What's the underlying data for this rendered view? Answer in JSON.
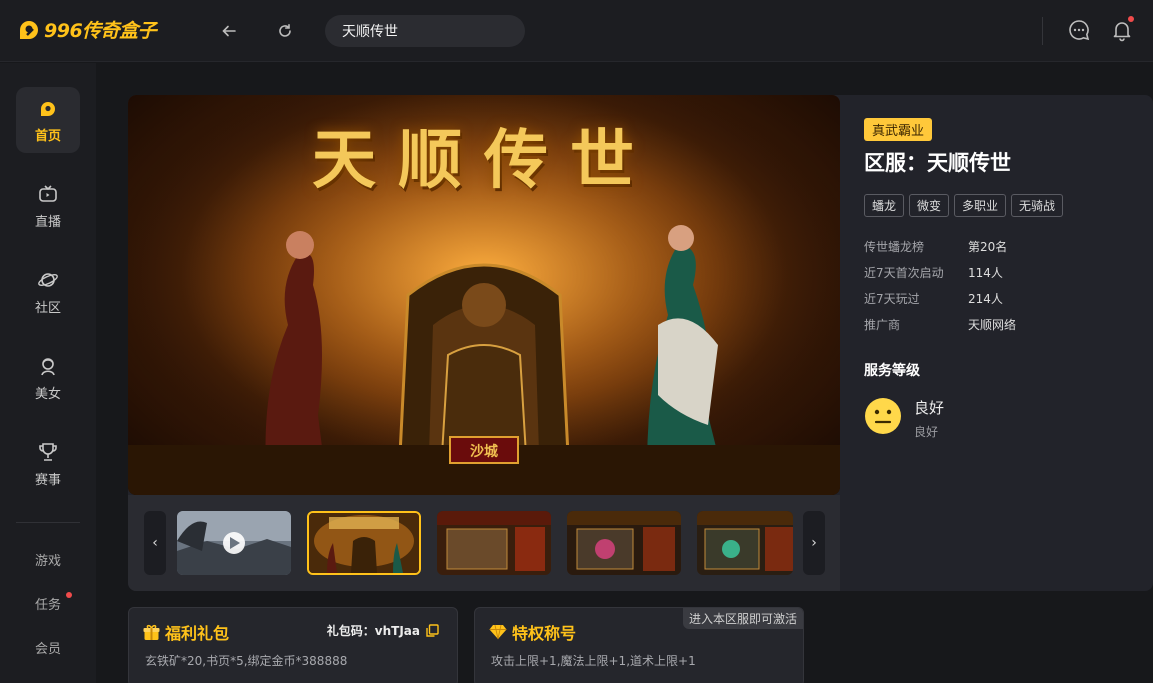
{
  "header": {
    "logo_text": "996传奇盒子",
    "search_value": "天顺传世",
    "colors": {
      "brand": "#ffc21a",
      "bg": "#17181b",
      "notify_dot": "#f04b4b"
    }
  },
  "sidebar": {
    "items": [
      {
        "label": "首页",
        "icon": "home-icon"
      },
      {
        "label": "直播",
        "icon": "tv-icon"
      },
      {
        "label": "社区",
        "icon": "planet-icon"
      },
      {
        "label": "美女",
        "icon": "girl-icon"
      },
      {
        "label": "赛事",
        "icon": "trophy-icon"
      }
    ],
    "links": [
      "游戏",
      "任务",
      "会员"
    ]
  },
  "hero": {
    "banner_title": "天顺传世",
    "banner_sign": "沙城"
  },
  "info": {
    "genre": "真武霸业",
    "server_name": "区服：天顺传世",
    "tags": [
      "蟠龙",
      "微变",
      "多职业",
      "无骑战"
    ],
    "stats": [
      {
        "label": "传世蟠龙榜",
        "value": "第20名"
      },
      {
        "label": "近7天首次启动",
        "value": "114人"
      },
      {
        "label": "近7天玩过",
        "value": "214人"
      },
      {
        "label": "推广商",
        "value": "天顺网络"
      }
    ],
    "service_heading": "服务等级",
    "service_level": "良好",
    "service_sub": "良好"
  },
  "cards": {
    "gift": {
      "title": "福利礼包",
      "code_label": "礼包码：vhTJaa",
      "desc": "玄铁矿*20,书页*5,绑定金币*388888"
    },
    "title": {
      "title": "特权称号",
      "note": "进入本区服即可激活",
      "desc": "攻击上限+1,魔法上限+1,道术上限+1"
    }
  }
}
